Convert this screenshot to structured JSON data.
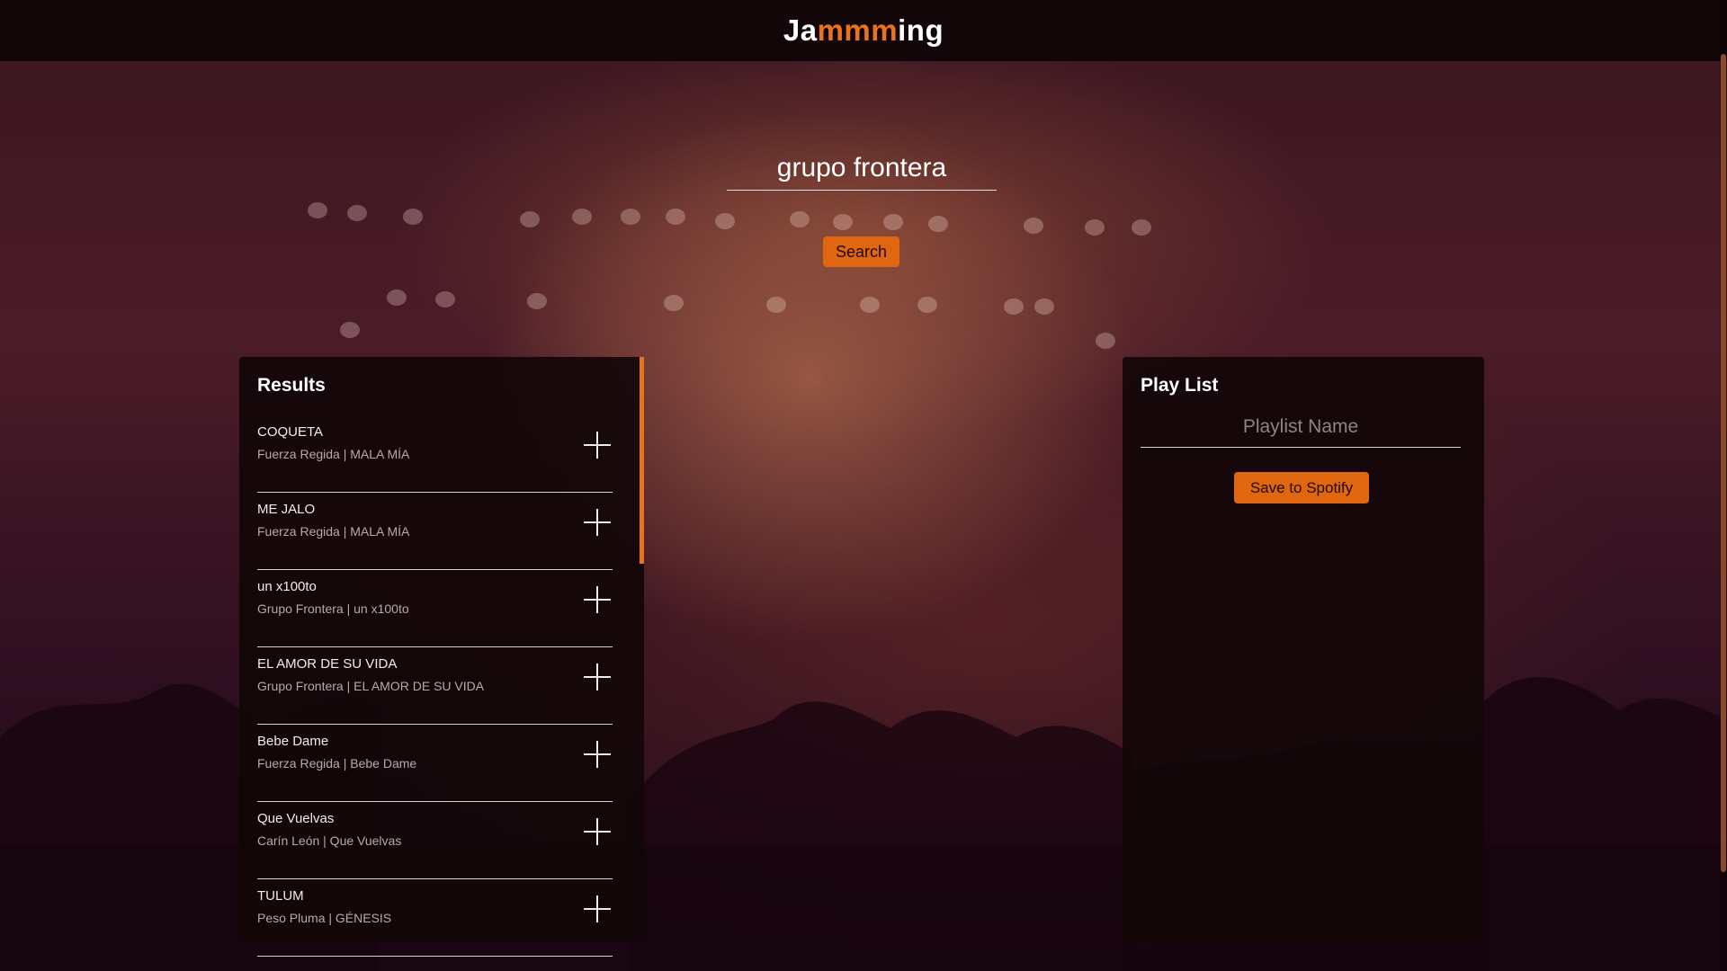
{
  "app": {
    "logo_prefix": "Ja",
    "logo_accent": "mmm",
    "logo_suffix": "ing"
  },
  "search": {
    "value": "grupo frontera",
    "button_label": "Search"
  },
  "results": {
    "title": "Results",
    "tracks": [
      {
        "name": "COQUETA",
        "info": "Fuerza Regida | MALA MÍA"
      },
      {
        "name": "ME JALO",
        "info": "Fuerza Regida | MALA MÍA"
      },
      {
        "name": "un x100to",
        "info": "Grupo Frontera | un x100to"
      },
      {
        "name": "EL AMOR DE SU VIDA",
        "info": "Grupo Frontera | EL AMOR DE SU VIDA"
      },
      {
        "name": "Bebe Dame",
        "info": "Fuerza Regida | Bebe Dame"
      },
      {
        "name": "Que Vuelvas",
        "info": "Carín León | Que Vuelvas"
      },
      {
        "name": "TULUM",
        "info": "Peso Pluma | GÉNESIS"
      }
    ]
  },
  "playlist": {
    "title": "Play List",
    "name_placeholder": "Playlist Name",
    "name_value": "",
    "save_label": "Save to Spotify"
  },
  "colors": {
    "accent": "#e0660f",
    "header_bg": "#130609",
    "panel_bg": "#120609"
  }
}
